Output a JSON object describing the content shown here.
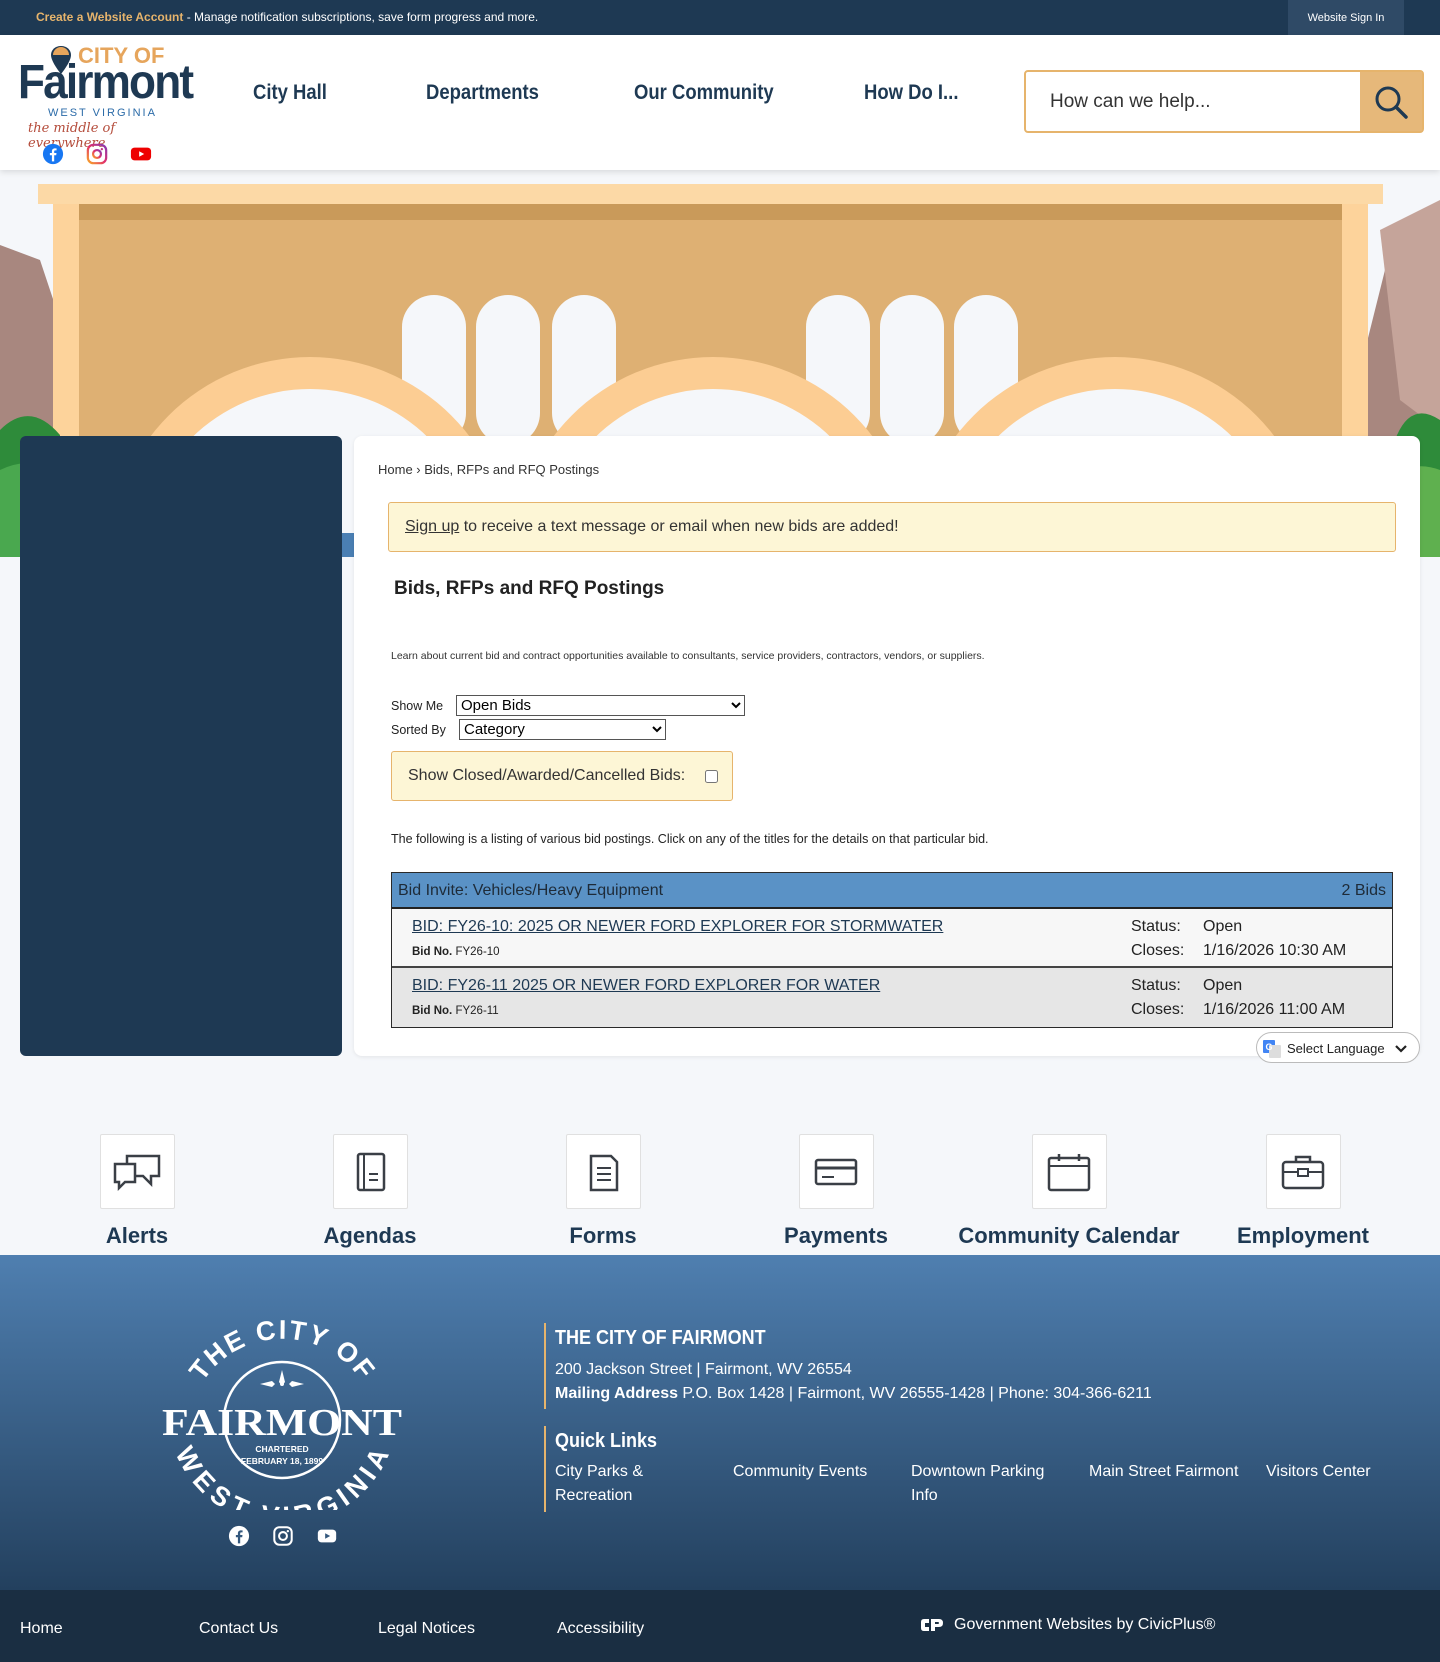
{
  "topbar": {
    "create_link": "Create a Website Account",
    "create_text": " - Manage notification subscriptions, save form progress and more.",
    "signin": "Website Sign In"
  },
  "logo": {
    "line1": "CITY OF",
    "line2": "Fairmont",
    "line3": "WEST VIRGINIA",
    "tagline": "the middle of everywhere"
  },
  "nav": {
    "items": [
      "City Hall",
      "Departments",
      "Our Community",
      "How Do I..."
    ]
  },
  "search": {
    "placeholder": "How can we help..."
  },
  "breadcrumb": {
    "home": "Home",
    "sep": " › ",
    "current": "Bids, RFPs and RFQ Postings"
  },
  "notice": {
    "link": "Sign up",
    "text": " to receive a text message or email when new bids are added!"
  },
  "page": {
    "title": "Bids, RFPs and RFQ Postings",
    "intro": "Learn about current bid and contract opportunities available to consultants, service providers, contractors, vendors, or suppliers.",
    "show_me_label": "Show Me",
    "show_me_value": "Open Bids",
    "sorted_by_label": "Sorted By",
    "sorted_by_value": "Category",
    "closed_label": "Show Closed/Awarded/Cancelled Bids:",
    "listing_text": "The following is a listing of various bid postings. Click on any of the titles for the details on that particular bid."
  },
  "bids": {
    "category": "Bid Invite: Vehicles/Heavy Equipment",
    "count": "2 Bids",
    "status_label": "Status:",
    "closes_label": "Closes:",
    "bid_no_label": "Bid No.",
    "rows": [
      {
        "title": "BID: FY26-10: 2025 OR NEWER FORD EXPLORER FOR STORMWATER",
        "bid_no": "FY26-10",
        "status": "Open",
        "closes": "1/16/2026 10:30 AM"
      },
      {
        "title": "BID: FY26-11 2025 OR NEWER FORD EXPLORER FOR WATER",
        "bid_no": "FY26-11",
        "status": "Open",
        "closes": "1/16/2026 11:00 AM"
      }
    ]
  },
  "translate": {
    "label": "Select Language"
  },
  "quick_icons": [
    "Alerts",
    "Agendas",
    "Forms",
    "Payments",
    "Community Calendar",
    "Employment"
  ],
  "footer": {
    "seal": {
      "top": "THE CITY OF",
      "name": "FAIRMONT",
      "chartered": "CHARTERED",
      "date": "FEBRUARY 18, 1899",
      "bottom": "WEST VIRGINIA"
    },
    "org_title": "THE CITY OF FAIRMONT",
    "address": "200 Jackson Street | Fairmont, WV 26554",
    "mailing_label": "Mailing Address",
    "mailing": " P.O. Box 1428 | Fairmont, WV 26555-1428 | Phone: 304-366-6211",
    "quick_links_title": "Quick Links",
    "quick_links": [
      "City Parks & Recreation",
      "Community Events",
      "Downtown Parking Info",
      "Main Street Fairmont",
      "Visitors Center"
    ]
  },
  "bottom": {
    "links": [
      "Home",
      "Contact Us",
      "Legal Notices",
      "Accessibility"
    ],
    "civicplus": "Government Websites by CivicPlus®"
  },
  "colors": {
    "navy": "#1e3953",
    "gold": "#e6b46c",
    "header_blue": "#5a92c6",
    "notice_bg": "#fdf6d6"
  }
}
